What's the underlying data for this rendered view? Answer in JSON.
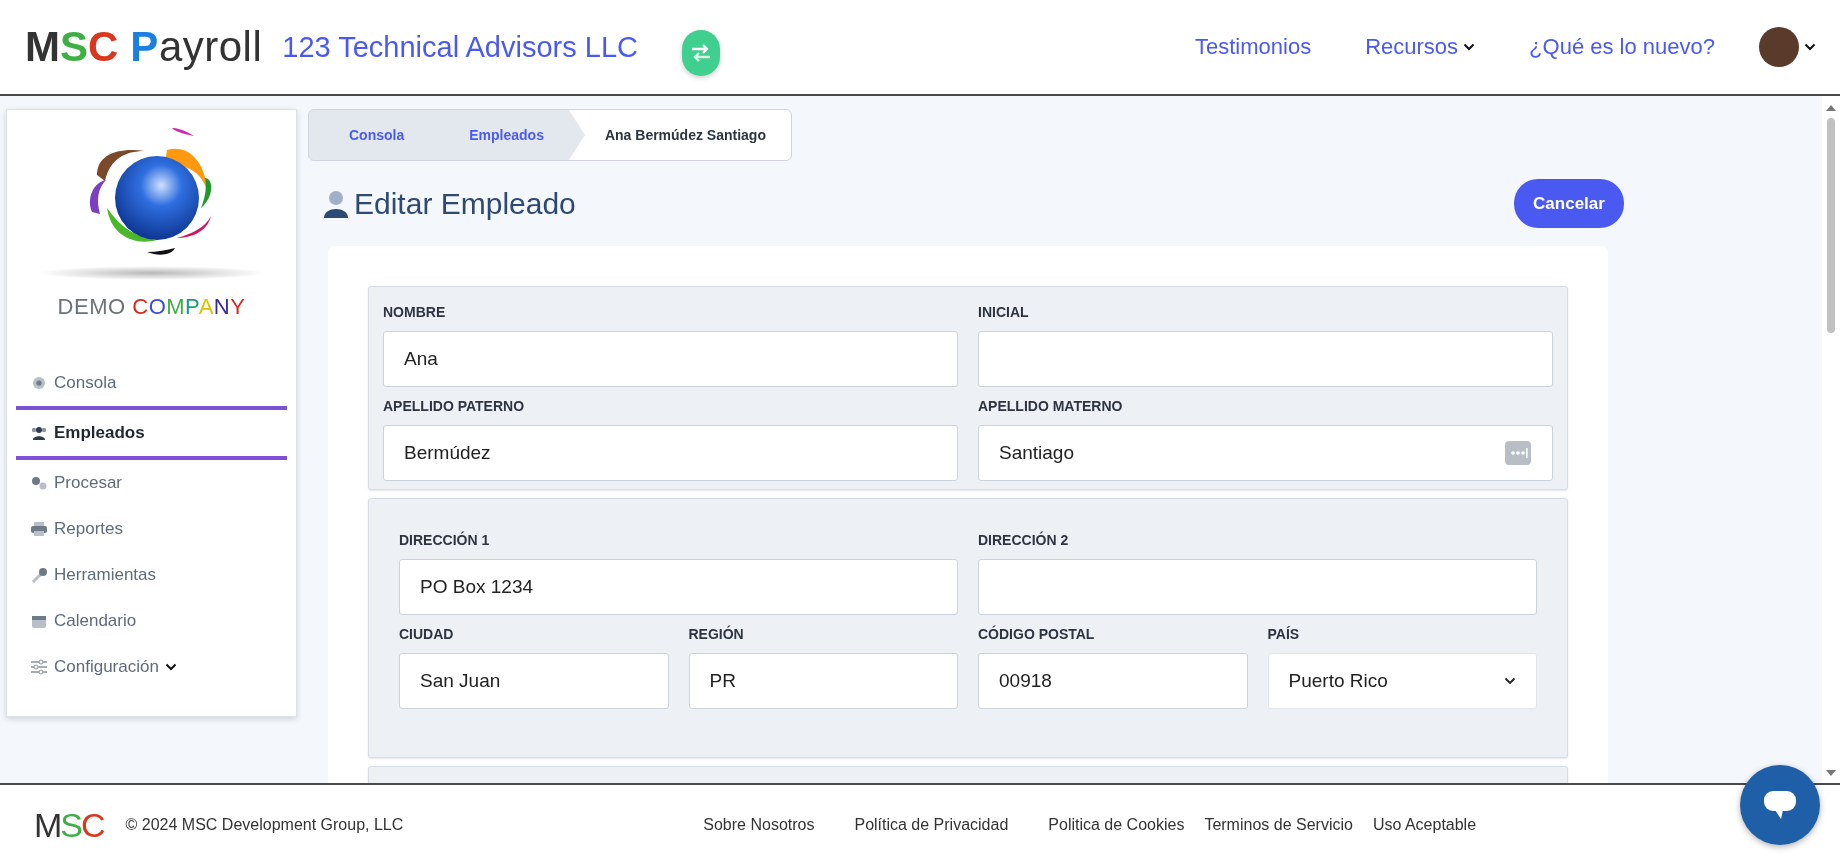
{
  "header": {
    "logo": {
      "letters": "MSC",
      "word": "Payroll"
    },
    "company": "123 Technical Advisors LLC",
    "nav": [
      {
        "label": "Testimonios",
        "kind": "link"
      },
      {
        "label": "Recursos",
        "kind": "dropdown"
      },
      {
        "label": "¿Qué es lo nuevo?",
        "kind": "link"
      }
    ]
  },
  "sidebar": {
    "company_logo": "DEMO COMPANY",
    "items": [
      {
        "label": "Consola",
        "selected": false,
        "kind": "link"
      },
      {
        "label": "Empleados",
        "selected": true,
        "kind": "link"
      },
      {
        "label": "Procesar",
        "selected": false,
        "kind": "link"
      },
      {
        "label": "Reportes",
        "selected": false,
        "kind": "link"
      },
      {
        "label": "Herramientas",
        "selected": false,
        "kind": "link"
      },
      {
        "label": "Calendario",
        "selected": false,
        "kind": "link"
      },
      {
        "label": "Configuración",
        "selected": false,
        "kind": "dropdown"
      }
    ]
  },
  "breadcrumb": [
    {
      "label": "Consola",
      "selected": false
    },
    {
      "label": "Empleados",
      "selected": false
    },
    {
      "label": "Ana Bermúdez Santiago",
      "selected": true
    }
  ],
  "page": {
    "title": "Editar Empleado",
    "cancel_button": "Cancelar"
  },
  "sections": [
    {
      "lines": [
        {
          "fields": [
            {
              "label": "NOMBRE",
              "value": "Ana",
              "kind": "text"
            },
            {
              "label": "INICIAL",
              "kind": "text"
            }
          ]
        },
        {
          "fields": [
            {
              "label": "APELLIDO PATERNO",
              "value": "Bermúdez",
              "kind": "text"
            },
            {
              "label": "APELLIDO MATERNO",
              "value": "Santiago",
              "kind": "text",
              "autofill_icon": true
            }
          ]
        }
      ]
    },
    {
      "lines": [
        {
          "fields": [
            {
              "label": "DIRECCIÓN 1",
              "value": "PO Box 1234",
              "kind": "text"
            },
            {
              "label": "DIRECCIÓN 2",
              "kind": "text"
            }
          ]
        },
        {
          "fields": [
            {
              "label": "CIUDAD",
              "value": "San Juan",
              "kind": "text"
            },
            {
              "label": "REGIÓN",
              "value": "PR",
              "kind": "text"
            },
            {
              "label": "CÓDIGO POSTAL",
              "value": "00918",
              "kind": "text"
            },
            {
              "label": "PAÍS",
              "value": "Puerto Rico",
              "kind": "select"
            }
          ]
        }
      ]
    }
  ],
  "footer": {
    "logo": "MSC",
    "copyright": "© 2024 MSC Development Group, LLC",
    "links": [
      "Sobre Nosotros",
      "Política de Privacidad",
      "Politica de Cookies",
      "Terminos de Servicio",
      "Uso Aceptable"
    ]
  }
}
